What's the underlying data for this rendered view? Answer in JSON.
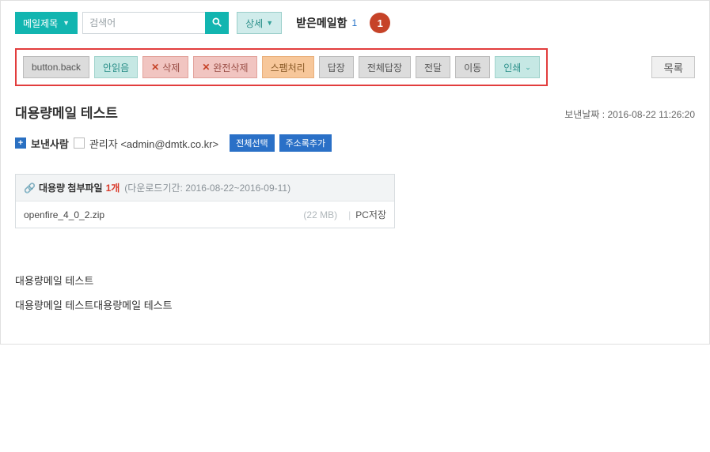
{
  "top": {
    "subject_filter": "메일제목",
    "search_placeholder": "검색어",
    "detail_label": "상세",
    "mailbox_label": "받은메일함",
    "mailbox_count": "1",
    "step_badge": "1"
  },
  "toolbar": {
    "back": "button.back",
    "unread": "안읽음",
    "delete": "삭제",
    "full_delete": "완전삭제",
    "spam": "스팸처리",
    "reply": "답장",
    "reply_all": "전체답장",
    "forward": "전달",
    "move": "이동",
    "print": "인쇄",
    "list": "목록"
  },
  "header": {
    "title": "대용량메일 테스트",
    "sent_date_label": "보낸날짜 :",
    "sent_date_value": "2016-08-22 11:26:20"
  },
  "from": {
    "label": "보낸사람",
    "name_email": "관리자 <admin@dmtk.co.kr>",
    "select_all": "전체선택",
    "add_address": "주소록추가"
  },
  "attachment": {
    "title": "대용량 첨부파일",
    "count": "1개",
    "period": "(다운로드기간: 2016-08-22~2016-09-11)",
    "file_name": "openfire_4_0_2.zip",
    "file_size": "(22 MB)",
    "pc_save": "PC저장"
  },
  "body": {
    "line1": "대용량메일 테스트",
    "line2": "대용량메일 테스트대용량메일 테스트"
  }
}
